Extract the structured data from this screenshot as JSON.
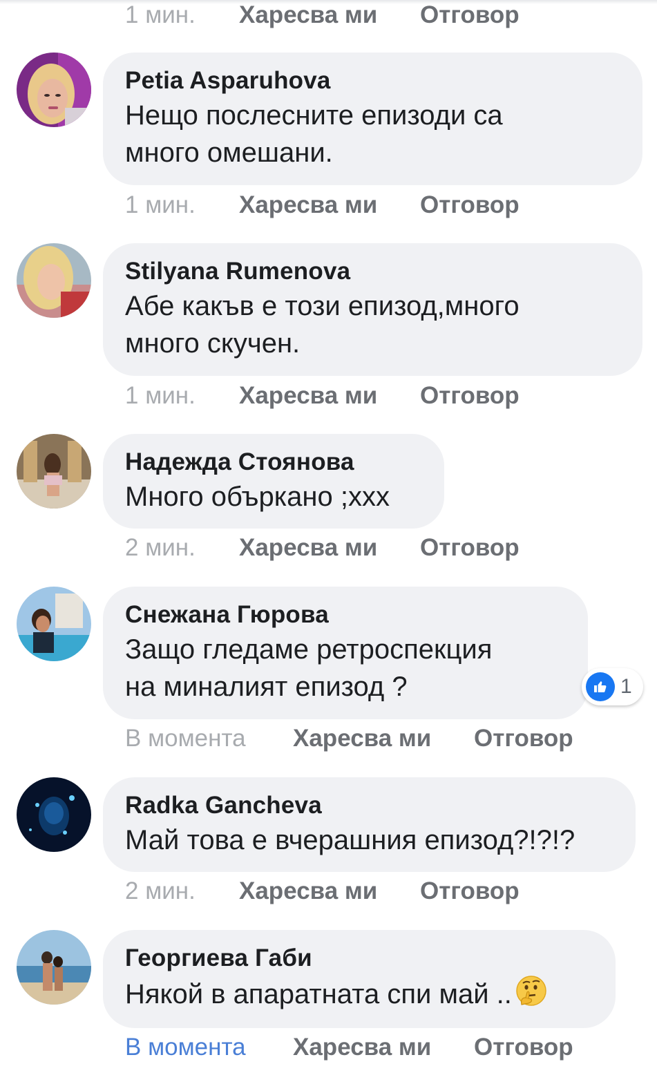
{
  "top_meta": {
    "time": "1 мин.",
    "like_label": "Харесва ми",
    "reply_label": "Отговор"
  },
  "comments": [
    {
      "author": "Petia Asparuhova",
      "text": "Нещо послесните епизоди са\nмного омешани.",
      "time": "1 мин.",
      "like_label": "Харесва ми",
      "reply_label": "Отговор"
    },
    {
      "author": "Stilyana Rumenova",
      "text": "Абе какъв е този епизод,много\nмного скучен.",
      "time": "1 мин.",
      "like_label": "Харесва ми",
      "reply_label": "Отговор"
    },
    {
      "author": "Надежда Стоянова",
      "text": "Много объркано ;ххх",
      "time": "2 мин.",
      "like_label": "Харесва ми",
      "reply_label": "Отговор"
    },
    {
      "author": "Снежана Гюрова",
      "text": "Защо гледаме ретроспекция\nна миналият епизод ?",
      "time": "В момента",
      "like_label": "Харесва ми",
      "reply_label": "Отговор",
      "reaction": {
        "icon": "thumbs-up-icon",
        "count": "1",
        "color": "#1877f2"
      }
    },
    {
      "author": "Radka Gancheva",
      "text": "Май това е вчерашния епизод?!?!?",
      "time": "2 мин.",
      "like_label": "Харесва ми",
      "reply_label": "Отговор"
    },
    {
      "author": "Георгиева Габи",
      "text": "Някой в апаратната спи май ..",
      "emoji": "thinking-face-icon",
      "time": "В момента",
      "time_color": "#4a7fd6",
      "like_label": "Харесва ми",
      "reply_label": "Отговор"
    }
  ],
  "colors": {
    "bubble": "#f0f1f4",
    "meta_time": "#a8abaf",
    "meta_action": "#6b6e73",
    "text": "#1c1e21"
  }
}
